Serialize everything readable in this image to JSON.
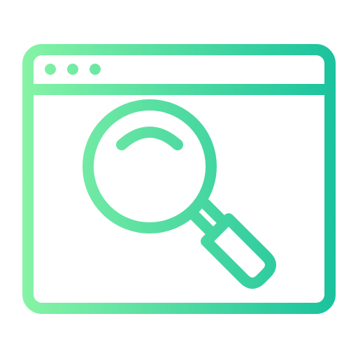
{
  "icon": {
    "name": "browser-search-icon",
    "gradient": {
      "start_color": "#8ef7a6",
      "end_color": "#12bf9d"
    }
  }
}
